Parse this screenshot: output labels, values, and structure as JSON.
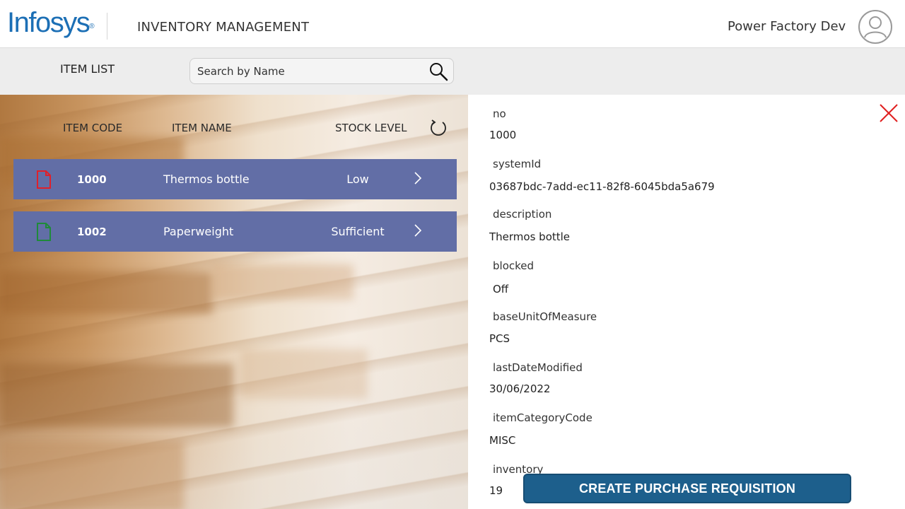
{
  "header": {
    "logo_text": "Infosys",
    "logo_mark": "®",
    "app_title": "INVENTORY MANAGEMENT",
    "user_name": "Power Factory Dev",
    "avatar_icon": "user-circle-icon"
  },
  "toolbar": {
    "section_label": "ITEM LIST",
    "search_placeholder": "Search by Name",
    "search_icon": "search-icon"
  },
  "item_list": {
    "columns": {
      "code": "ITEM CODE",
      "name": "ITEM NAME",
      "stock": "STOCK LEVEL"
    },
    "refresh_icon": "refresh-icon",
    "row_color": "#626ea6",
    "rows": [
      {
        "code": "1000",
        "name": "Thermos bottle",
        "stock": "Low",
        "doc_color": "#e0202a"
      },
      {
        "code": "1002",
        "name": "Paperweight",
        "stock": "Sufficient",
        "doc_color": "#1f8a3a"
      }
    ]
  },
  "details": {
    "close_icon": "close-icon",
    "fields": [
      {
        "label": "no",
        "value": "1000"
      },
      {
        "label": "systemId",
        "value": "03687bdc-7add-ec11-82f8-6045bda5a679"
      },
      {
        "label": "description",
        "value": "Thermos bottle"
      },
      {
        "label": "blocked",
        "value": "Off"
      },
      {
        "label": "baseUnitOfMeasure",
        "value": "PCS"
      },
      {
        "label": "lastDateModified",
        "value": "30/06/2022"
      },
      {
        "label": "itemCategoryCode",
        "value": "MISC"
      },
      {
        "label": "inventory",
        "value": "19"
      }
    ],
    "cta_label": "CREATE PURCHASE REQUISITION",
    "cta_color": "#1d5f8c"
  }
}
